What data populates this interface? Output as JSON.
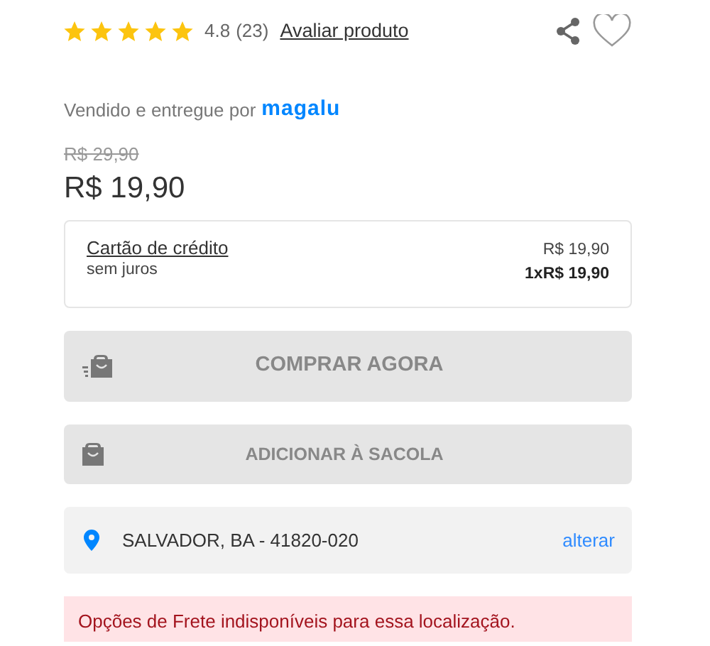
{
  "rating": {
    "stars": 5,
    "score": "4.8",
    "count": "(23)",
    "review_link": "Avaliar produto"
  },
  "favorite": {
    "selected": false
  },
  "seller": {
    "label": "Vendido e entregue por",
    "brand": "magalu"
  },
  "price": {
    "old": "R$ 29,90",
    "current": "R$ 19,90"
  },
  "payment": {
    "method": "Cartão de crédito",
    "note": "sem juros",
    "total": "R$ 19,90",
    "installments": "1xR$ 19,90"
  },
  "buttons": [
    {
      "kind": "buy-now",
      "label": "COMPRAR AGORA",
      "disabled": true
    },
    {
      "kind": "add-to-bag",
      "label": "ADICIONAR À SACOLA",
      "disabled": true
    }
  ],
  "location": {
    "address": "SALVADOR, BA - 41820-020",
    "change_link": "alterar"
  },
  "alert": "Opções de Frete indisponíveis para essa localização."
}
